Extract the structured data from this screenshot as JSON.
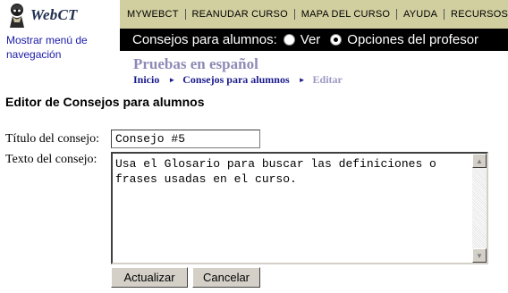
{
  "logo": {
    "text": "WebCT",
    "icon": "webct-logo-figure-icon"
  },
  "topnav": {
    "items": [
      {
        "label": "MYWEBCT"
      },
      {
        "label": "REANUDAR CURSO"
      },
      {
        "label": "MAPA DEL CURSO"
      },
      {
        "label": "AYUDA"
      },
      {
        "label": "RECURSOS"
      }
    ]
  },
  "sidebar": {
    "show_nav_label": "Mostrar menú de navegación"
  },
  "tips_bar": {
    "label": "Consejos para alumnos:",
    "options": [
      {
        "label": "Ver",
        "checked": false
      },
      {
        "label": "Opciones del profesor",
        "checked": true
      }
    ]
  },
  "course": {
    "title": "Pruebas en español"
  },
  "breadcrumb": {
    "items": [
      {
        "label": "Inicio"
      },
      {
        "label": "Consejos para alumnos"
      }
    ],
    "current": "Editar"
  },
  "page": {
    "title": "Editor de Consejos para alumnos"
  },
  "form": {
    "title_label": "Título del consejo:",
    "title_value": "Consejo #5",
    "text_label": "Texto del consejo:",
    "text_value": "Usa el Glosario para buscar las definiciones o\nfrases usadas en el curso.",
    "update_button": "Actualizar",
    "cancel_button": "Cancelar"
  },
  "colors": {
    "nav_bar": "#d1cf9f",
    "tips_bar": "#000000",
    "course_title": "#8d8bb6",
    "link": "#1a1aa8"
  }
}
